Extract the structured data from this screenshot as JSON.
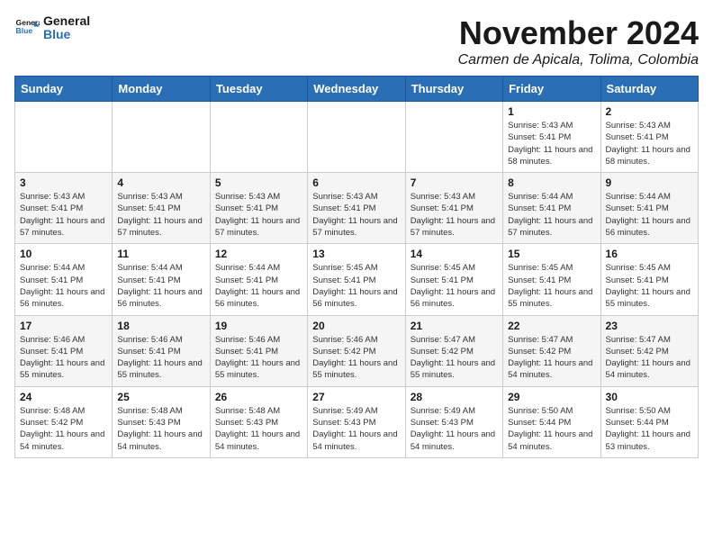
{
  "logo": {
    "general": "General",
    "blue": "Blue"
  },
  "title": {
    "month_year": "November 2024",
    "location": "Carmen de Apicala, Tolima, Colombia"
  },
  "weekdays": [
    "Sunday",
    "Monday",
    "Tuesday",
    "Wednesday",
    "Thursday",
    "Friday",
    "Saturday"
  ],
  "weeks": [
    [
      {
        "day": "",
        "info": ""
      },
      {
        "day": "",
        "info": ""
      },
      {
        "day": "",
        "info": ""
      },
      {
        "day": "",
        "info": ""
      },
      {
        "day": "",
        "info": ""
      },
      {
        "day": "1",
        "info": "Sunrise: 5:43 AM\nSunset: 5:41 PM\nDaylight: 11 hours and 58 minutes."
      },
      {
        "day": "2",
        "info": "Sunrise: 5:43 AM\nSunset: 5:41 PM\nDaylight: 11 hours and 58 minutes."
      }
    ],
    [
      {
        "day": "3",
        "info": "Sunrise: 5:43 AM\nSunset: 5:41 PM\nDaylight: 11 hours and 57 minutes."
      },
      {
        "day": "4",
        "info": "Sunrise: 5:43 AM\nSunset: 5:41 PM\nDaylight: 11 hours and 57 minutes."
      },
      {
        "day": "5",
        "info": "Sunrise: 5:43 AM\nSunset: 5:41 PM\nDaylight: 11 hours and 57 minutes."
      },
      {
        "day": "6",
        "info": "Sunrise: 5:43 AM\nSunset: 5:41 PM\nDaylight: 11 hours and 57 minutes."
      },
      {
        "day": "7",
        "info": "Sunrise: 5:43 AM\nSunset: 5:41 PM\nDaylight: 11 hours and 57 minutes."
      },
      {
        "day": "8",
        "info": "Sunrise: 5:44 AM\nSunset: 5:41 PM\nDaylight: 11 hours and 57 minutes."
      },
      {
        "day": "9",
        "info": "Sunrise: 5:44 AM\nSunset: 5:41 PM\nDaylight: 11 hours and 56 minutes."
      }
    ],
    [
      {
        "day": "10",
        "info": "Sunrise: 5:44 AM\nSunset: 5:41 PM\nDaylight: 11 hours and 56 minutes."
      },
      {
        "day": "11",
        "info": "Sunrise: 5:44 AM\nSunset: 5:41 PM\nDaylight: 11 hours and 56 minutes."
      },
      {
        "day": "12",
        "info": "Sunrise: 5:44 AM\nSunset: 5:41 PM\nDaylight: 11 hours and 56 minutes."
      },
      {
        "day": "13",
        "info": "Sunrise: 5:45 AM\nSunset: 5:41 PM\nDaylight: 11 hours and 56 minutes."
      },
      {
        "day": "14",
        "info": "Sunrise: 5:45 AM\nSunset: 5:41 PM\nDaylight: 11 hours and 56 minutes."
      },
      {
        "day": "15",
        "info": "Sunrise: 5:45 AM\nSunset: 5:41 PM\nDaylight: 11 hours and 55 minutes."
      },
      {
        "day": "16",
        "info": "Sunrise: 5:45 AM\nSunset: 5:41 PM\nDaylight: 11 hours and 55 minutes."
      }
    ],
    [
      {
        "day": "17",
        "info": "Sunrise: 5:46 AM\nSunset: 5:41 PM\nDaylight: 11 hours and 55 minutes."
      },
      {
        "day": "18",
        "info": "Sunrise: 5:46 AM\nSunset: 5:41 PM\nDaylight: 11 hours and 55 minutes."
      },
      {
        "day": "19",
        "info": "Sunrise: 5:46 AM\nSunset: 5:41 PM\nDaylight: 11 hours and 55 minutes."
      },
      {
        "day": "20",
        "info": "Sunrise: 5:46 AM\nSunset: 5:42 PM\nDaylight: 11 hours and 55 minutes."
      },
      {
        "day": "21",
        "info": "Sunrise: 5:47 AM\nSunset: 5:42 PM\nDaylight: 11 hours and 55 minutes."
      },
      {
        "day": "22",
        "info": "Sunrise: 5:47 AM\nSunset: 5:42 PM\nDaylight: 11 hours and 54 minutes."
      },
      {
        "day": "23",
        "info": "Sunrise: 5:47 AM\nSunset: 5:42 PM\nDaylight: 11 hours and 54 minutes."
      }
    ],
    [
      {
        "day": "24",
        "info": "Sunrise: 5:48 AM\nSunset: 5:42 PM\nDaylight: 11 hours and 54 minutes."
      },
      {
        "day": "25",
        "info": "Sunrise: 5:48 AM\nSunset: 5:43 PM\nDaylight: 11 hours and 54 minutes."
      },
      {
        "day": "26",
        "info": "Sunrise: 5:48 AM\nSunset: 5:43 PM\nDaylight: 11 hours and 54 minutes."
      },
      {
        "day": "27",
        "info": "Sunrise: 5:49 AM\nSunset: 5:43 PM\nDaylight: 11 hours and 54 minutes."
      },
      {
        "day": "28",
        "info": "Sunrise: 5:49 AM\nSunset: 5:43 PM\nDaylight: 11 hours and 54 minutes."
      },
      {
        "day": "29",
        "info": "Sunrise: 5:50 AM\nSunset: 5:44 PM\nDaylight: 11 hours and 54 minutes."
      },
      {
        "day": "30",
        "info": "Sunrise: 5:50 AM\nSunset: 5:44 PM\nDaylight: 11 hours and 53 minutes."
      }
    ]
  ]
}
